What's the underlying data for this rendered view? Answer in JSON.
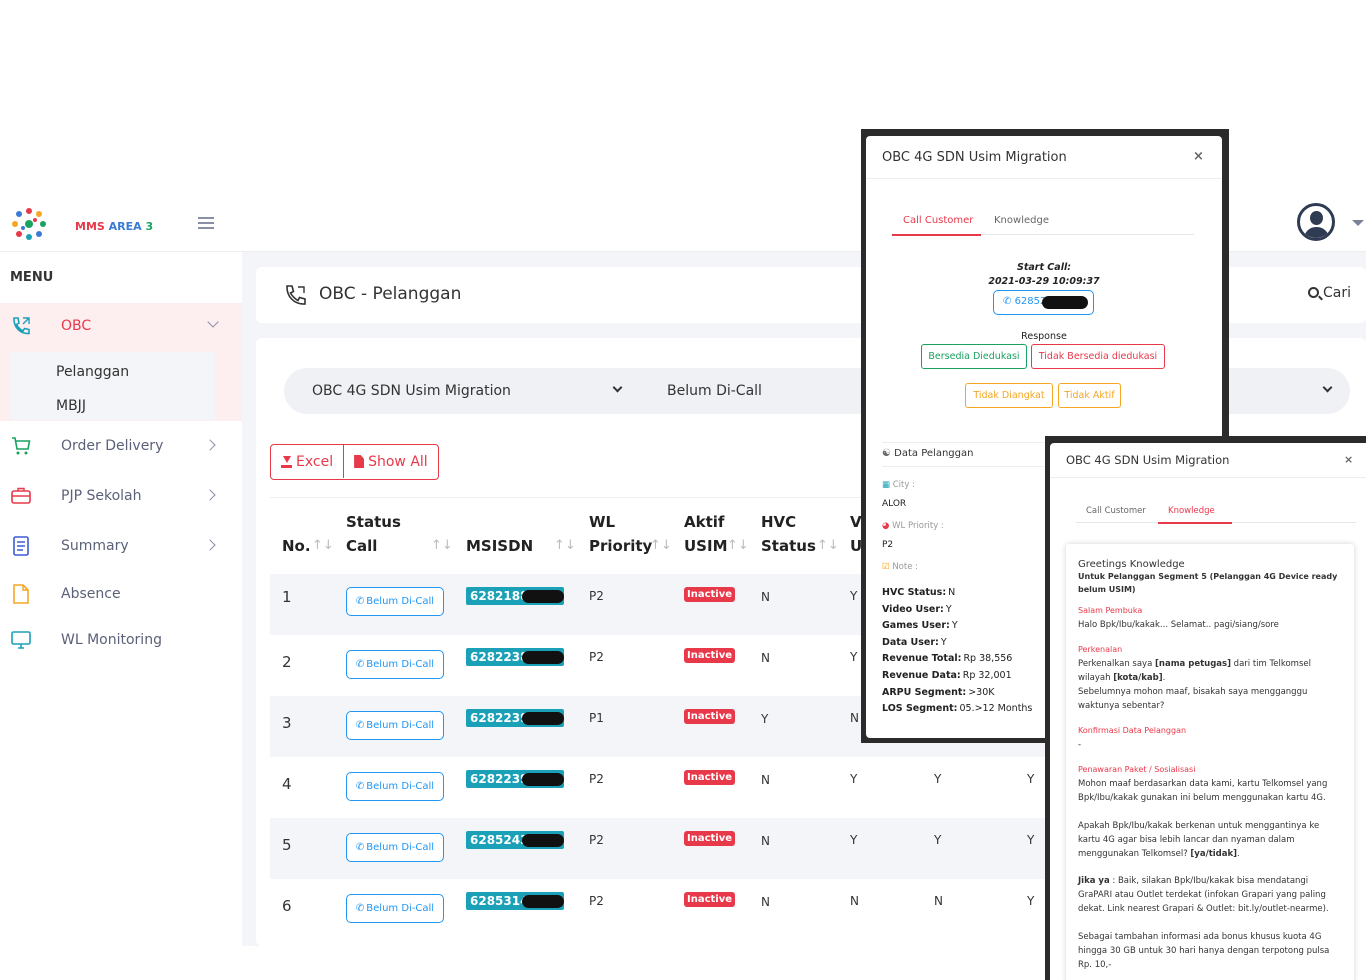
{
  "topbar": {
    "brand_a": "MMS",
    "brand_b": "AREA",
    "brand_c": "3"
  },
  "sidebar": {
    "menu_title": "MENU",
    "items": [
      {
        "label": "OBC",
        "icon": "phone-call-icon"
      },
      {
        "label": "Order Delivery",
        "icon": "cart-icon"
      },
      {
        "label": "PJP Sekolah",
        "icon": "briefcase-icon"
      },
      {
        "label": "Summary",
        "icon": "document-icon"
      },
      {
        "label": "Absence",
        "icon": "file-icon"
      },
      {
        "label": "WL Monitoring",
        "icon": "monitor-icon"
      }
    ],
    "sub_items": [
      "Pelanggan",
      "MBJJ"
    ]
  },
  "header": {
    "title": "OBC - Pelanggan",
    "search_label": "Cari"
  },
  "filters": {
    "campaign": "OBC 4G SDN Usim Migration",
    "status": "Belum Di-Call"
  },
  "buttons": {
    "excel": "Excel",
    "show_all": "Show All"
  },
  "table": {
    "headers": {
      "no": "No.",
      "status_a": "Status",
      "status_b": "Call",
      "msisdn": "MSISDN",
      "wl_a": "WL",
      "wl_b": "Priority",
      "aktif_a": "Aktif",
      "aktif_b": "USIM",
      "hvc_a": "HVC",
      "hvc_b": "Status",
      "v_a": "V",
      "v_b": "U"
    },
    "sort_glyph": "↑↓",
    "rows": [
      {
        "no": "1",
        "status": "Belum Di-Call",
        "msisdn": "62821889",
        "wl": "P2",
        "usim": "Inactive",
        "hvc": "N",
        "c6": "Y",
        "c7": "",
        "c8": ""
      },
      {
        "no": "2",
        "status": "Belum Di-Call",
        "msisdn": "62822381",
        "wl": "P2",
        "usim": "Inactive",
        "hvc": "N",
        "c6": "Y",
        "c7": "",
        "c8": ""
      },
      {
        "no": "3",
        "status": "Belum Di-Call",
        "msisdn": "62822394",
        "wl": "P1",
        "usim": "Inactive",
        "hvc": "Y",
        "c6": "N",
        "c7": "",
        "c8": ""
      },
      {
        "no": "4",
        "status": "Belum Di-Call",
        "msisdn": "62822395",
        "wl": "P2",
        "usim": "Inactive",
        "hvc": "N",
        "c6": "Y",
        "c7": "Y",
        "c8": "Y"
      },
      {
        "no": "5",
        "status": "Belum Di-Call",
        "msisdn": "6285243",
        "wl": "P2",
        "usim": "Inactive",
        "hvc": "N",
        "c6": "Y",
        "c7": "Y",
        "c8": "Y"
      },
      {
        "no": "6",
        "status": "Belum Di-Call",
        "msisdn": "62853147",
        "wl": "P2",
        "usim": "Inactive",
        "hvc": "N",
        "c6": "N",
        "c7": "N",
        "c8": "Y"
      }
    ]
  },
  "modal1": {
    "title": "OBC 4G SDN Usim Migration",
    "close": "×",
    "tab_call": "Call Customer",
    "tab_knowledge": "Knowledge",
    "start_call_label": "Start Call:",
    "start_call_time": "2021-03-29 10:09:37",
    "phone": "628523",
    "response_label": "Response",
    "resp_1": "Bersedia Diedukasi",
    "resp_2": "Tidak Bersedia diedukasi",
    "resp_3": "Tidak Diangkat",
    "resp_4": "Tidak Aktif",
    "data_title": "Data Pelanggan",
    "city_label": "City :",
    "city_value": "ALOR",
    "wl_label": "WL Priority :",
    "wl_value": "P2",
    "note_label": "Note :",
    "details": [
      {
        "k": "HVC Status:",
        "v": "N"
      },
      {
        "k": "Video User:",
        "v": "Y"
      },
      {
        "k": "Games User:",
        "v": "Y"
      },
      {
        "k": "Data User:",
        "v": "Y"
      },
      {
        "k": "Revenue Total:",
        "v": "Rp 38,556"
      },
      {
        "k": "Revenue Data:",
        "v": "Rp 32,001"
      },
      {
        "k": "ARPU Segment:",
        "v": ">30K"
      },
      {
        "k": "LOS Segment:",
        "v": "05.>12 Months"
      }
    ]
  },
  "modal2": {
    "title": "OBC 4G SDN Usim Migration",
    "close": "×",
    "tab_call": "Call Customer",
    "tab_knowledge": "Knowledge",
    "kb_title": "Greetings Knowledge",
    "kb_subtitle": "Untuk Pelanggan Segment 5 (Pelanggan 4G Device ready belum USIM)",
    "salam_hdr": "Salam Pembuka",
    "salam_txt": "Halo Bpk/Ibu/kakak... Selamat.. pagi/siang/sore",
    "kenal_hdr": "Perkenalan",
    "kenal_txt_a": "Perkenalkan saya",
    "kenal_bold_a": "[nama petugas]",
    "kenal_txt_b": "dari tim Telkomsel wilayah",
    "kenal_bold_b": "[kota/kab]",
    "kenal_txt_c": "Sebelumnya mohon maaf, bisakah saya mengganggu waktunya sebentar?",
    "konf_hdr": "Konfirmasi Data Pelanggan",
    "konf_txt": "-",
    "tawar_hdr": "Penawaran Paket / Sosialisasi",
    "tawar_txt_1": "Mohon maaf berdasarkan data kami, kartu Telkomsel yang Bpk/Ibu/kakak gunakan ini belum menggunakan kartu 4G.",
    "tawar_txt_2a": "Apakah Bpk/Ibu/kakak berkenan untuk menggantinya ke kartu 4G agar bisa lebih lancar dan nyaman dalam menggunakan Telkomsel?",
    "tawar_txt_2b": "[ya/tidak]",
    "jika_bold": "Jika ya",
    "jika_txt": ": Baik, silakan Bpk/Ibu/kakak bisa mendatangi GraPARI atau Outlet terdekat (infokan Grapari yang paling dekat. Link nearest Grapari & Outlet: bit.ly/outlet-nearme).",
    "bonus_txt": "Sebagai tambahan informasi ada bonus khusus kuota 4G hingga 30 GB untuk 30 hari hanya dengan terpotong pulsa Rp. 10,-"
  }
}
